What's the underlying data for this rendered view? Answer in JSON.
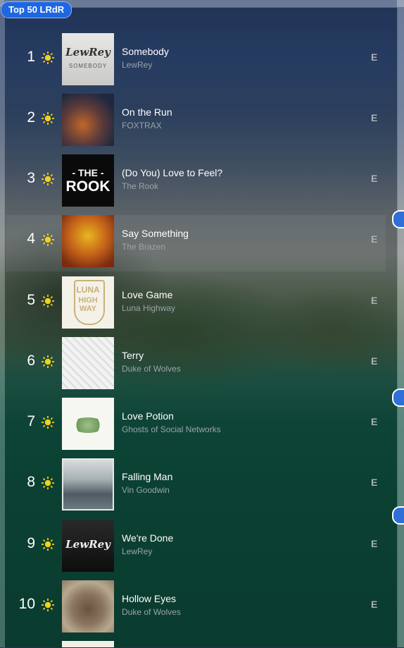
{
  "playlist": {
    "title": "Top 50 LRdR"
  },
  "colors": {
    "accent": "#1f67e0",
    "sun": "#f2d21a"
  },
  "tracks": [
    {
      "rank": "1",
      "title": "Somebody",
      "artist": "LewRey",
      "explicit": "E",
      "art_text": "LewRey",
      "art_sub": "SOMEBODY",
      "icon": "sun-icon"
    },
    {
      "rank": "2",
      "title": "On the Run",
      "artist": "FOXTRAX",
      "explicit": "E",
      "art_text": "",
      "art_sub": "",
      "icon": "sun-icon"
    },
    {
      "rank": "3",
      "title": "(Do You) Love to Feel?",
      "artist": "The Rook",
      "explicit": "E",
      "art_text": "- THE -",
      "art_sub": "ROOK",
      "icon": "sun-icon"
    },
    {
      "rank": "4",
      "title": "Say Something",
      "artist": "The Brazen",
      "explicit": "E",
      "art_text": "",
      "art_sub": "",
      "icon": "sun-icon"
    },
    {
      "rank": "5",
      "title": "Love Game",
      "artist": "Luna Highway",
      "explicit": "E",
      "art_text": "LUNA",
      "art_sub": "HIGH WAY",
      "icon": "sun-icon"
    },
    {
      "rank": "6",
      "title": "Terry",
      "artist": "Duke of Wolves",
      "explicit": "E",
      "art_text": "",
      "art_sub": "",
      "icon": "sun-icon"
    },
    {
      "rank": "7",
      "title": "Love Potion",
      "artist": "Ghosts of Social Networks",
      "explicit": "E",
      "art_text": "",
      "art_sub": "",
      "icon": "sun-icon"
    },
    {
      "rank": "8",
      "title": "Falling Man",
      "artist": "Vin Goodwin",
      "explicit": "E",
      "art_text": "",
      "art_sub": "",
      "icon": "sun-icon"
    },
    {
      "rank": "9",
      "title": "We're Done",
      "artist": "LewRey",
      "explicit": "E",
      "art_text": "LewRey",
      "art_sub": "",
      "icon": "sun-icon"
    },
    {
      "rank": "10",
      "title": "Hollow Eyes",
      "artist": "Duke of Wolves",
      "explicit": "E",
      "art_text": "",
      "art_sub": "",
      "icon": "sun-icon"
    }
  ]
}
